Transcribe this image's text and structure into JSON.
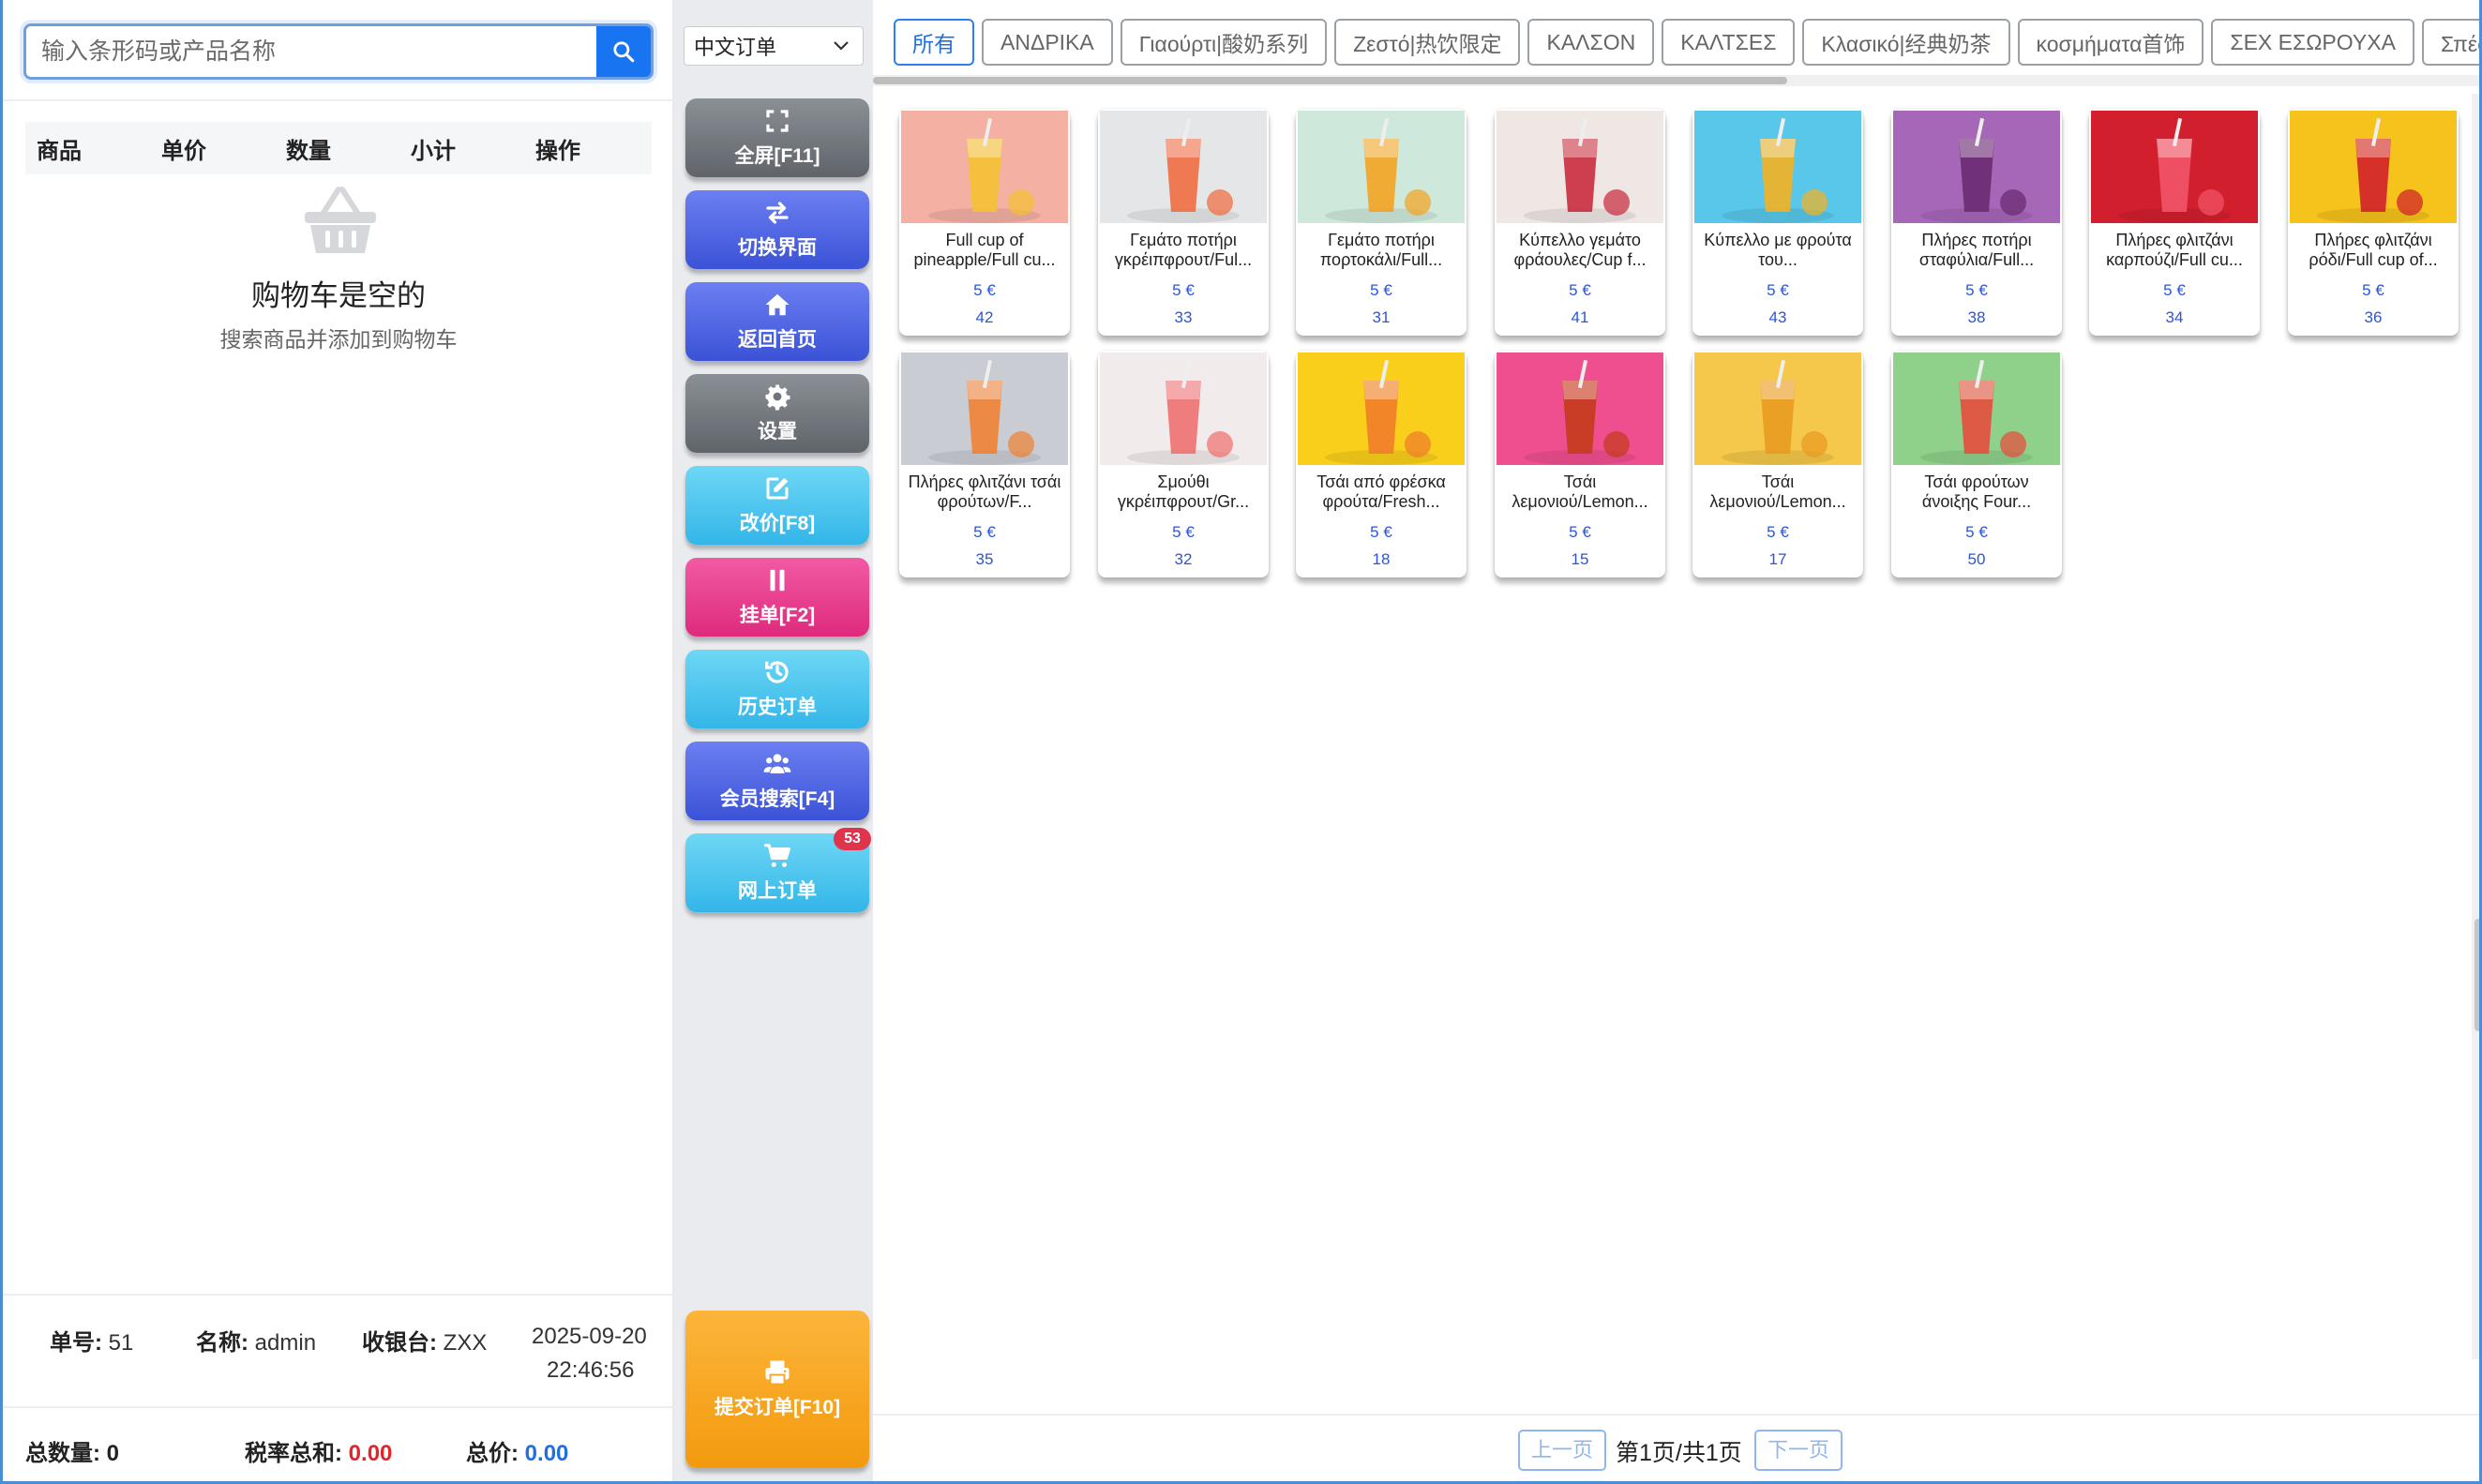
{
  "search": {
    "placeholder": "输入条形码或产品名称"
  },
  "cart": {
    "columns": [
      "商品",
      "单价",
      "数量",
      "小计",
      "操作"
    ],
    "empty_title": "购物车是空的",
    "empty_subtitle": "搜索商品并添加到购物车"
  },
  "order_info": {
    "order_no_label": "单号:",
    "order_no": "51",
    "name_label": "名称:",
    "name": "admin",
    "cashier_label": "收银台:",
    "cashier": "ZXX",
    "date": "2025-09-20",
    "time": "22:46:56"
  },
  "totals": {
    "qty_label": "总数量:",
    "qty": "0",
    "tax_label": "税率总和:",
    "tax": "0.00",
    "price_label": "总价:",
    "price": "0.00",
    "tax_color": "#e0262c",
    "price_color": "#1f6fe0"
  },
  "order_type": {
    "selected": "中文订单"
  },
  "function_buttons": [
    {
      "label": "全屏[F11]",
      "icon": "fullscreen-icon",
      "style": "gray"
    },
    {
      "label": "切换界面",
      "icon": "swap-icon",
      "style": "blue"
    },
    {
      "label": "返回首页",
      "icon": "home-icon",
      "style": "blue"
    },
    {
      "label": "设置",
      "icon": "gear-icon",
      "style": "gray"
    },
    {
      "label": "改价[F8]",
      "icon": "edit-icon",
      "style": "cyan"
    },
    {
      "label": "挂单[F2]",
      "icon": "pause-icon",
      "style": "pink"
    },
    {
      "label": "历史订单",
      "icon": "history-icon",
      "style": "cyan"
    },
    {
      "label": "会员搜索[F4]",
      "icon": "users-icon",
      "style": "blue"
    },
    {
      "label": "网上订单",
      "icon": "cart-icon",
      "style": "cyan",
      "badge": "53"
    }
  ],
  "submit_button": {
    "label": "提交订单[F10]",
    "icon": "printer-icon"
  },
  "category_tabs": [
    "所有",
    "ΑΝΔΡΙΚΑ",
    "Γιαούρτι|酸奶系列",
    "Ζεστό|热饮限定",
    "ΚΑΛΣΟΝ",
    "ΚΑΛΤΣΕΣ",
    "Κλασικό|经典奶茶",
    "κοσμήματα首饰",
    "ΣΕΧ ΕΣΩΡΟΥΧΑ",
    "Σπέσιαλ|特调饮品"
  ],
  "products": [
    {
      "name": "Full cup of pineapple/Full cu...",
      "price": "5 €",
      "stock": "42",
      "bg": "#f4b0a3",
      "accent": "#f5c230"
    },
    {
      "name": "Γεμάτο ποτήρι γκρέιπφρουτ/Ful...",
      "price": "5 €",
      "stock": "33",
      "bg": "#e4e6e8",
      "accent": "#f06a3c"
    },
    {
      "name": "Γεμάτο ποτήρι πορτοκάλι/Full...",
      "price": "5 €",
      "stock": "31",
      "bg": "#cfe8dc",
      "accent": "#f5a21c"
    },
    {
      "name": "Κύπελλο γεμάτο φράουλες/Cup f...",
      "price": "5 €",
      "stock": "41",
      "bg": "#efe7e4",
      "accent": "#c8283a"
    },
    {
      "name": "Κύπελλο με φρούτα του...",
      "price": "5 €",
      "stock": "43",
      "bg": "#58c7ea",
      "accent": "#f7b21e"
    },
    {
      "name": "Πλήρες ποτήρι σταφύλια/Full...",
      "price": "5 €",
      "stock": "38",
      "bg": "#a667b8",
      "accent": "#6a2a6e"
    },
    {
      "name": "Πλήρες φλιτζάνι καρπούζι/Full cu...",
      "price": "5 €",
      "stock": "34",
      "bg": "#d21f2d",
      "accent": "#f2566a"
    },
    {
      "name": "Πλήρες φλιτζάνι ρόδι/Full cup of...",
      "price": "5 €",
      "stock": "36",
      "bg": "#f6c21c",
      "accent": "#d01d2a"
    },
    {
      "name": "Πλήρες φλιτζάνι τσάι φρούτων/F...",
      "price": "5 €",
      "stock": "35",
      "bg": "#c9cdd3",
      "accent": "#f08030"
    },
    {
      "name": "Σμούθι γκρέιπφρουτ/Gr...",
      "price": "5 €",
      "stock": "32",
      "bg": "#f1eceb",
      "accent": "#ee6d6d"
    },
    {
      "name": "Τσάι από φρέσκα φρούτα/Fresh...",
      "price": "5 €",
      "stock": "18",
      "bg": "#f9cf1b",
      "accent": "#f07b2a"
    },
    {
      "name": "Τσάι λεμονιού/Lemon...",
      "price": "5 €",
      "stock": "15",
      "bg": "#ef4f8f",
      "accent": "#c43b18"
    },
    {
      "name": "Τσάι λεμονιού/Lemon...",
      "price": "5 €",
      "stock": "17",
      "bg": "#f5c74a",
      "accent": "#e89a20"
    },
    {
      "name": "Τσάι φρούτων άνοιξης Four...",
      "price": "5 €",
      "stock": "50",
      "bg": "#8fd18a",
      "accent": "#e84a3a"
    }
  ],
  "pagination": {
    "prev": "上一页",
    "info": "第1页/共1页",
    "next": "下一页"
  }
}
